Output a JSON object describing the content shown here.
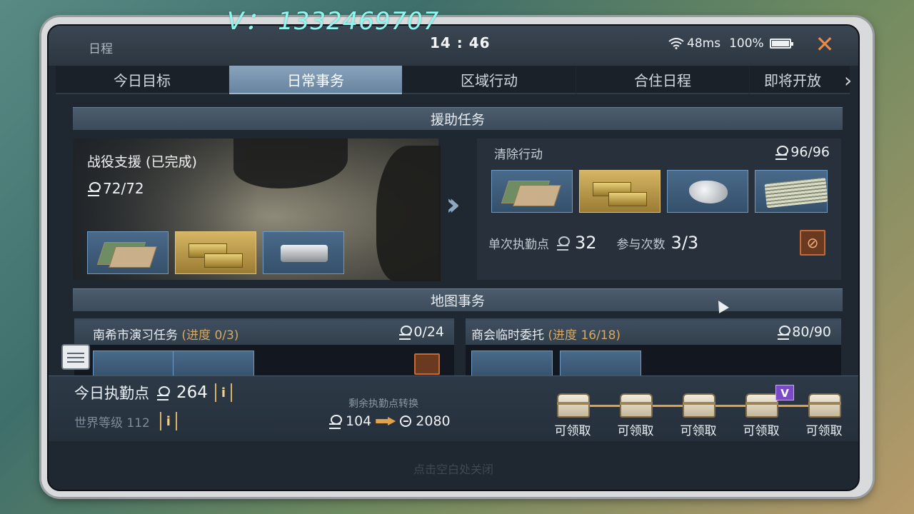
{
  "watermark": "V： 1332469707",
  "status": {
    "title": "日程",
    "clock": "14 : 46",
    "network": "48ms",
    "battery": "100%"
  },
  "tabs": [
    "今日目标",
    "日常事务",
    "区域行动",
    "合住日程",
    "即将开放"
  ],
  "active_tab_index": 1,
  "sections": {
    "assist": "援助任务",
    "map": "地图事务"
  },
  "assist_left": {
    "title": "战役支援 (已完成)",
    "points": "72/72"
  },
  "assist_right": {
    "title": "清除行动",
    "points": "96/96",
    "single_label": "单次执勤点",
    "single_value": "32",
    "count_label": "参与次数",
    "count_value": "3/3"
  },
  "map_events": [
    {
      "name": "南希市演习任务",
      "progress": "(进度 0/3)",
      "points": "0/24"
    },
    {
      "name": "商会临时委托",
      "progress": "(进度 16/18)",
      "points": "80/90"
    }
  ],
  "bottom": {
    "today_label": "今日执勤点",
    "today_value": "264",
    "world_label": "世界等级 112",
    "convert_title": "剩余执勤点转换",
    "convert_from": "104",
    "convert_to": "2080",
    "chest_label": "可领取",
    "chest_badge": "V",
    "close_hint": "点击空白处关闭"
  },
  "info_glyph": "i",
  "colors": {
    "accent_tab": "#6784a0",
    "gold": "#d6b664",
    "orange": "#e88a4a"
  }
}
